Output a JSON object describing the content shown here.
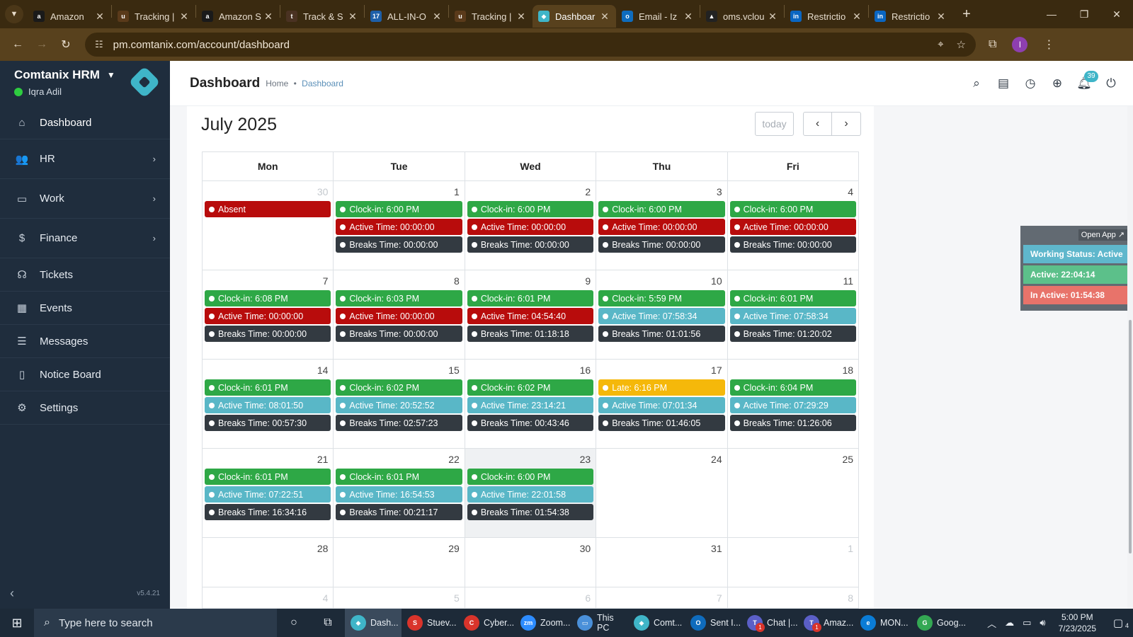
{
  "browser": {
    "tabs": [
      {
        "title": "Amazon",
        "favicon_letter": "a",
        "favicon_color": "#1a1a1a"
      },
      {
        "title": "Tracking |",
        "favicon_letter": "u",
        "favicon_color": "#5a3a1a"
      },
      {
        "title": "Amazon S",
        "favicon_letter": "a",
        "favicon_color": "#1a1a1a"
      },
      {
        "title": "Track & S",
        "favicon_letter": "t",
        "favicon_color": "#4a3222"
      },
      {
        "title": "ALL-IN-O",
        "favicon_letter": "17",
        "favicon_color": "#1e5fa8"
      },
      {
        "title": "Tracking |",
        "favicon_letter": "u",
        "favicon_color": "#5a3a1a"
      },
      {
        "title": "Dashboar",
        "favicon_letter": "◆",
        "favicon_color": "#3fb5c8",
        "active": true
      },
      {
        "title": "Email - Iz",
        "favicon_letter": "o",
        "favicon_color": "#0f6cbd"
      },
      {
        "title": "oms.vclou",
        "favicon_letter": "▲",
        "favicon_color": "#222222"
      },
      {
        "title": "Restrictio",
        "favicon_letter": "in",
        "favicon_color": "#0a66c2"
      },
      {
        "title": "Restrictio",
        "favicon_letter": "in",
        "favicon_color": "#0a66c2"
      }
    ],
    "url": "pm.comtanix.com/account/dashboard",
    "profile_initial": "I"
  },
  "sidebar": {
    "brand": "Comtanix HRM",
    "user": "Iqra Adil",
    "items": [
      {
        "label": "Dashboard",
        "icon": "home-icon",
        "glyph": "⌂",
        "name": "dashboard"
      },
      {
        "label": "HR",
        "icon": "users-icon",
        "glyph": "👥",
        "name": "hr",
        "chevron": "›"
      },
      {
        "label": "Work",
        "icon": "briefcase-icon",
        "glyph": "▭",
        "name": "work",
        "chevron": "›"
      },
      {
        "label": "Finance",
        "icon": "dollar-icon",
        "glyph": "$",
        "name": "finance",
        "chevron": "›"
      },
      {
        "label": "Tickets",
        "icon": "headset-icon",
        "glyph": "☊",
        "name": "tickets"
      },
      {
        "label": "Events",
        "icon": "calendar-icon",
        "glyph": "▦",
        "name": "events"
      },
      {
        "label": "Messages",
        "icon": "chat-icon",
        "glyph": "☰",
        "name": "messages"
      },
      {
        "label": "Notice Board",
        "icon": "clipboard-icon",
        "glyph": "▯",
        "name": "notice-board"
      },
      {
        "label": "Settings",
        "icon": "gear-icon",
        "glyph": "⚙",
        "name": "settings"
      }
    ],
    "version": "v5.4.21"
  },
  "header": {
    "title": "Dashboard",
    "breadcrumb_home": "Home",
    "breadcrumb_sep": "•",
    "breadcrumb_current": "Dashboard",
    "notification_count": "39"
  },
  "calendar": {
    "title": "July 2025",
    "today_label": "today",
    "weekdays": [
      "Mon",
      "Tue",
      "Wed",
      "Thu",
      "Fri"
    ],
    "weeks": [
      [
        {
          "day": "30",
          "other": true,
          "events": [
            {
              "text": "Absent",
              "color": "red"
            }
          ]
        },
        {
          "day": "1",
          "events": [
            {
              "text": "Clock-in: 6:00 PM",
              "color": "green"
            },
            {
              "text": "Active Time: 00:00:00",
              "color": "red"
            },
            {
              "text": "Breaks Time: 00:00:00",
              "color": "dark"
            }
          ]
        },
        {
          "day": "2",
          "events": [
            {
              "text": "Clock-in: 6:00 PM",
              "color": "green"
            },
            {
              "text": "Active Time: 00:00:00",
              "color": "red"
            },
            {
              "text": "Breaks Time: 00:00:00",
              "color": "dark"
            }
          ]
        },
        {
          "day": "3",
          "events": [
            {
              "text": "Clock-in: 6:00 PM",
              "color": "green"
            },
            {
              "text": "Active Time: 00:00:00",
              "color": "red"
            },
            {
              "text": "Breaks Time: 00:00:00",
              "color": "dark"
            }
          ]
        },
        {
          "day": "4",
          "events": [
            {
              "text": "Clock-in: 6:00 PM",
              "color": "green"
            },
            {
              "text": "Active Time: 00:00:00",
              "color": "red"
            },
            {
              "text": "Breaks Time: 00:00:00",
              "color": "dark"
            }
          ]
        }
      ],
      [
        {
          "day": "7",
          "events": [
            {
              "text": "Clock-in: 6:08 PM",
              "color": "green"
            },
            {
              "text": "Active Time: 00:00:00",
              "color": "red"
            },
            {
              "text": "Breaks Time: 00:00:00",
              "color": "dark"
            }
          ]
        },
        {
          "day": "8",
          "events": [
            {
              "text": "Clock-in: 6:03 PM",
              "color": "green"
            },
            {
              "text": "Active Time: 00:00:00",
              "color": "red"
            },
            {
              "text": "Breaks Time: 00:00:00",
              "color": "dark"
            }
          ]
        },
        {
          "day": "9",
          "events": [
            {
              "text": "Clock-in: 6:01 PM",
              "color": "green"
            },
            {
              "text": "Active Time: 04:54:40",
              "color": "red"
            },
            {
              "text": "Breaks Time: 01:18:18",
              "color": "dark"
            }
          ]
        },
        {
          "day": "10",
          "events": [
            {
              "text": "Clock-in: 5:59 PM",
              "color": "green"
            },
            {
              "text": "Active Time: 07:58:34",
              "color": "teal"
            },
            {
              "text": "Breaks Time: 01:01:56",
              "color": "dark"
            }
          ]
        },
        {
          "day": "11",
          "events": [
            {
              "text": "Clock-in: 6:01 PM",
              "color": "green"
            },
            {
              "text": "Active Time: 07:58:34",
              "color": "teal"
            },
            {
              "text": "Breaks Time: 01:20:02",
              "color": "dark"
            }
          ]
        }
      ],
      [
        {
          "day": "14",
          "events": [
            {
              "text": "Clock-in: 6:01 PM",
              "color": "green"
            },
            {
              "text": "Active Time: 08:01:50",
              "color": "teal"
            },
            {
              "text": "Breaks Time: 00:57:30",
              "color": "dark"
            }
          ]
        },
        {
          "day": "15",
          "events": [
            {
              "text": "Clock-in: 6:02 PM",
              "color": "green"
            },
            {
              "text": "Active Time: 20:52:52",
              "color": "teal"
            },
            {
              "text": "Breaks Time: 02:57:23",
              "color": "dark"
            }
          ]
        },
        {
          "day": "16",
          "events": [
            {
              "text": "Clock-in: 6:02 PM",
              "color": "green"
            },
            {
              "text": "Active Time: 23:14:21",
              "color": "teal"
            },
            {
              "text": "Breaks Time: 00:43:46",
              "color": "dark"
            }
          ]
        },
        {
          "day": "17",
          "events": [
            {
              "text": "Late: 6:16 PM",
              "color": "yellow"
            },
            {
              "text": "Active Time: 07:01:34",
              "color": "teal"
            },
            {
              "text": "Breaks Time: 01:46:05",
              "color": "dark"
            }
          ]
        },
        {
          "day": "18",
          "events": [
            {
              "text": "Clock-in: 6:04 PM",
              "color": "green"
            },
            {
              "text": "Active Time: 07:29:29",
              "color": "teal"
            },
            {
              "text": "Breaks Time: 01:26:06",
              "color": "dark"
            }
          ]
        }
      ],
      [
        {
          "day": "21",
          "events": [
            {
              "text": "Clock-in: 6:01 PM",
              "color": "green"
            },
            {
              "text": "Active Time: 07:22:51",
              "color": "teal"
            },
            {
              "text": "Breaks Time: 16:34:16",
              "color": "dark"
            }
          ]
        },
        {
          "day": "22",
          "events": [
            {
              "text": "Clock-in: 6:01 PM",
              "color": "green"
            },
            {
              "text": "Active Time: 16:54:53",
              "color": "teal"
            },
            {
              "text": "Breaks Time: 00:21:17",
              "color": "dark"
            }
          ]
        },
        {
          "day": "23",
          "today": true,
          "events": [
            {
              "text": "Clock-in: 6:00 PM",
              "color": "green"
            },
            {
              "text": "Active Time: 22:01:58",
              "color": "teal"
            },
            {
              "text": "Breaks Time: 01:54:38",
              "color": "dark"
            }
          ]
        },
        {
          "day": "24",
          "events": []
        },
        {
          "day": "25",
          "events": []
        }
      ],
      [
        {
          "day": "28",
          "events": []
        },
        {
          "day": "29",
          "events": []
        },
        {
          "day": "30",
          "events": []
        },
        {
          "day": "31",
          "events": []
        },
        {
          "day": "1",
          "other": true,
          "events": []
        }
      ],
      [
        {
          "day": "4",
          "other": true,
          "events": []
        },
        {
          "day": "5",
          "other": true,
          "events": []
        },
        {
          "day": "6",
          "other": true,
          "events": []
        },
        {
          "day": "7",
          "other": true,
          "events": []
        },
        {
          "day": "8",
          "other": true,
          "events": []
        }
      ]
    ]
  },
  "status_widget": {
    "open_app": "Open App ↗",
    "working_status": "Working Status: Active",
    "active": "Active: 22:04:14",
    "inactive": "In Active: 01:54:38"
  },
  "taskbar": {
    "search_placeholder": "Type here to search",
    "apps": [
      {
        "label": "Dash...",
        "color": "#3fb5c8",
        "letter": "◆",
        "active": true
      },
      {
        "label": "Stuev...",
        "color": "#d9342b",
        "letter": "S"
      },
      {
        "label": "Cyber...",
        "color": "#d9342b",
        "letter": "C"
      },
      {
        "label": "Zoom...",
        "color": "#2d8cff",
        "letter": "zm"
      },
      {
        "label": "This PC",
        "color": "#4a90d9",
        "letter": "▭"
      },
      {
        "label": "Comt...",
        "color": "#3fb5c8",
        "letter": "◆"
      },
      {
        "label": "Sent I...",
        "color": "#0f6cbd",
        "letter": "O"
      },
      {
        "label": "Chat |...",
        "color": "#5b5fc7",
        "letter": "T",
        "badge": "1"
      },
      {
        "label": "Amaz...",
        "color": "#5b5fc7",
        "letter": "T",
        "badge": "1"
      },
      {
        "label": "MON...",
        "color": "#0a7cd6",
        "letter": "e"
      },
      {
        "label": "Goog...",
        "color": "#34a853",
        "letter": "G"
      }
    ],
    "time": "5:00 PM",
    "date": "7/23/2025",
    "notification_count": "4"
  }
}
